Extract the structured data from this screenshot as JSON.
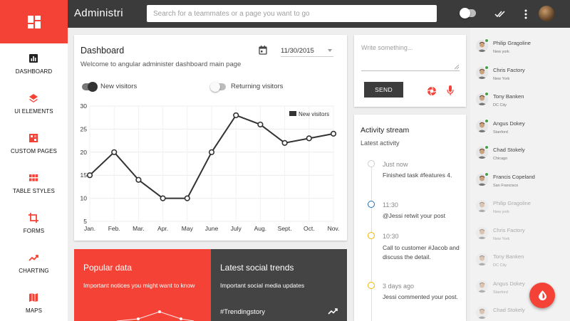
{
  "header": {
    "app_title": "Administri",
    "search_placeholder": "Search for a teammates or a page you want to go"
  },
  "sidebar": {
    "items": [
      {
        "label": "DASHBOARD",
        "icon": "chart-icon"
      },
      {
        "label": "UI ELEMENTS",
        "icon": "layers-icon"
      },
      {
        "label": "CUSTOM PAGES",
        "icon": "pages-icon"
      },
      {
        "label": "TABLE STYLES",
        "icon": "grid-icon"
      },
      {
        "label": "FORMS",
        "icon": "crop-icon"
      },
      {
        "label": "CHARTING",
        "icon": "trending-icon"
      },
      {
        "label": "MAPS",
        "icon": "map-icon"
      }
    ]
  },
  "dashboard": {
    "title": "Dashboard",
    "subtitle": "Welcome to angular administer dashboard main page",
    "date": "11/30/2015",
    "toggle_new": "New visitors",
    "toggle_returning": "Returning visitors"
  },
  "chart_data": {
    "type": "line",
    "categories": [
      "Jan.",
      "Feb.",
      "Mar.",
      "Apr.",
      "May",
      "June",
      "July",
      "Aug.",
      "Sept.",
      "Oct.",
      "Nov."
    ],
    "series": [
      {
        "name": "New visitors",
        "values": [
          15,
          20,
          14,
          10,
          10,
          20,
          28,
          26,
          22,
          23,
          24
        ]
      }
    ],
    "y_ticks": [
      5,
      10,
      15,
      20,
      25,
      30
    ],
    "ylim": [
      5,
      30
    ],
    "grid": true,
    "legend": "top-right",
    "line_color": "#333333"
  },
  "tiles": {
    "popular_title": "Popular data",
    "popular_sub": "Important notices you might want to know",
    "social_title": "Latest social trends",
    "social_sub": "Important social media updates",
    "social_tag": "#Trendingstory"
  },
  "compose": {
    "placeholder": "Write something...",
    "send_label": "SEND"
  },
  "activity": {
    "title": "Activity stream",
    "subtitle": "Latest activity",
    "items": [
      {
        "time": "Just now",
        "text": "Finished task #features 4.",
        "color": "#cccccc"
      },
      {
        "time": "11:30",
        "text": "@Jessi retwit your post",
        "color": "#1e6fb5"
      },
      {
        "time": "10:30",
        "text": "Call to customer #Jacob and discuss the detail.",
        "color": "#f4b400"
      },
      {
        "time": "3 days ago",
        "text": "Jessi commented your post.",
        "color": "#f4b400"
      }
    ]
  },
  "contacts": [
    {
      "name": "Philip Gragoline",
      "location": "New york",
      "online": true
    },
    {
      "name": "Chris Factory",
      "location": "New York",
      "online": true
    },
    {
      "name": "Tony Banken",
      "location": "DC City",
      "online": true
    },
    {
      "name": "Angus Dokey",
      "location": "Stanford",
      "online": true
    },
    {
      "name": "Chad Stokely",
      "location": "Chicago",
      "online": true
    },
    {
      "name": "Francis Copeland",
      "location": "San Francisco",
      "online": true
    },
    {
      "name": "Philip Gragoline",
      "location": "New york",
      "online": false
    },
    {
      "name": "Chris Factory",
      "location": "New York",
      "online": false
    },
    {
      "name": "Tony Banken",
      "location": "DC City",
      "online": false
    },
    {
      "name": "Angus Dokey",
      "location": "Stanford",
      "online": false
    },
    {
      "name": "Chad Stokely",
      "location": "",
      "online": false
    }
  ],
  "colors": {
    "accent": "#f44336",
    "dark": "#3b3b3b",
    "online": "#43a047"
  }
}
